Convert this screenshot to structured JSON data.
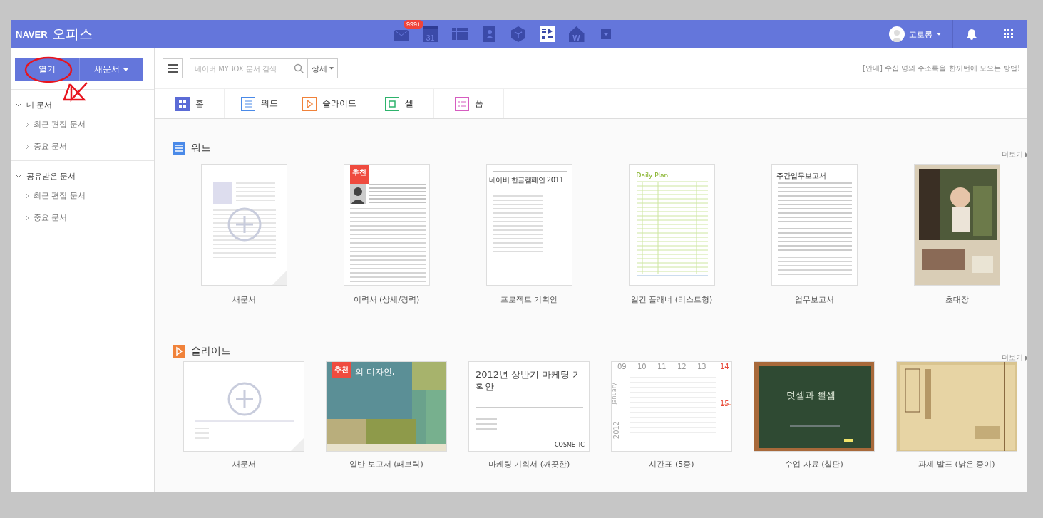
{
  "app": {
    "brand": "NAVER",
    "name": "오피스"
  },
  "header": {
    "apps": [
      {
        "kind": "mail",
        "badge": "999+"
      },
      {
        "kind": "calendar",
        "label": "31"
      },
      {
        "kind": "list"
      },
      {
        "kind": "contacts"
      },
      {
        "kind": "cube"
      },
      {
        "kind": "board"
      },
      {
        "kind": "home",
        "label": "W"
      },
      {
        "kind": "more"
      }
    ],
    "user": {
      "name": "고로롱"
    }
  },
  "sidebar": {
    "buttons": [
      {
        "label": "열기",
        "kind": "plain"
      },
      {
        "label": "새문서",
        "kind": "dropdown"
      }
    ],
    "sections": [
      {
        "label": "내 문서",
        "expanded": true,
        "children": [
          {
            "label": "최근 편집 문서"
          },
          {
            "label": "중요 문서"
          }
        ]
      },
      {
        "label": "공유받은 문서",
        "expanded": true,
        "children": [
          {
            "label": "최근 편집 문서"
          },
          {
            "label": "중요 문서"
          }
        ]
      }
    ]
  },
  "toolbar": {
    "search": {
      "placeholder": "네이버 MYBOX 문서 검색"
    },
    "detail": "상세",
    "notice": "[안내] 수십 명의 주소록을 한꺼번에 모으는 방법!"
  },
  "tabs": [
    {
      "label": "홈",
      "kind": "home",
      "selected": true
    },
    {
      "label": "워드",
      "kind": "word",
      "selected": false
    },
    {
      "label": "슬라이드",
      "kind": "slide",
      "selected": false
    },
    {
      "label": "셀",
      "kind": "cell",
      "selected": false
    },
    {
      "label": "폼",
      "kind": "form",
      "selected": false
    }
  ],
  "sections": [
    {
      "kind": "word",
      "title": "워드",
      "more": "더보기",
      "templates": [
        {
          "label": "새문서",
          "thumb": {
            "kind": "blank"
          }
        },
        {
          "label": "이력서 (상세/경력)",
          "thumb": {
            "kind": "resume",
            "badge": "추천"
          }
        },
        {
          "label": "프로젝트 기획안",
          "thumb": {
            "kind": "doc",
            "title": "네이버 한글캠페인 2011"
          }
        },
        {
          "label": "일간 플래너 (리스트형)",
          "thumb": {
            "kind": "planner",
            "title": "Daily Plan"
          }
        },
        {
          "label": "업무보고서",
          "thumb": {
            "kind": "report",
            "title": "주간업무보고서"
          }
        },
        {
          "label": "초대장"
        }
      ]
    },
    {
      "kind": "slide",
      "title": "슬라이드",
      "more": "더보기",
      "templates": [
        {
          "label": "새문서",
          "thumb": {
            "kind": "blank"
          }
        },
        {
          "label": "일반 보고서 (패브릭)",
          "thumb": {
            "kind": "fabric",
            "badge": "추천",
            "title": "의 디자인,"
          }
        },
        {
          "label": "마케팅 기획서 (깨끗한)",
          "thumb": {
            "kind": "title",
            "title": "2012년 상반기 마케팅 기획안",
            "footer": "COSMETIC"
          }
        },
        {
          "label": "시간표 (5종)",
          "thumb": {
            "kind": "calendar",
            "days": [
              "09",
              "10",
              "11",
              "12",
              "13"
            ],
            "weekend": [
              "14",
              "15"
            ],
            "month": "January",
            "year": "2012"
          }
        },
        {
          "label": "수업 자료 (칠판)",
          "thumb": {
            "kind": "chalkboard",
            "title": "덧셈과 뺄셈"
          }
        },
        {
          "label": "과제 발표 (낡은 종이)",
          "thumb": {
            "kind": "paper"
          }
        }
      ]
    }
  ]
}
